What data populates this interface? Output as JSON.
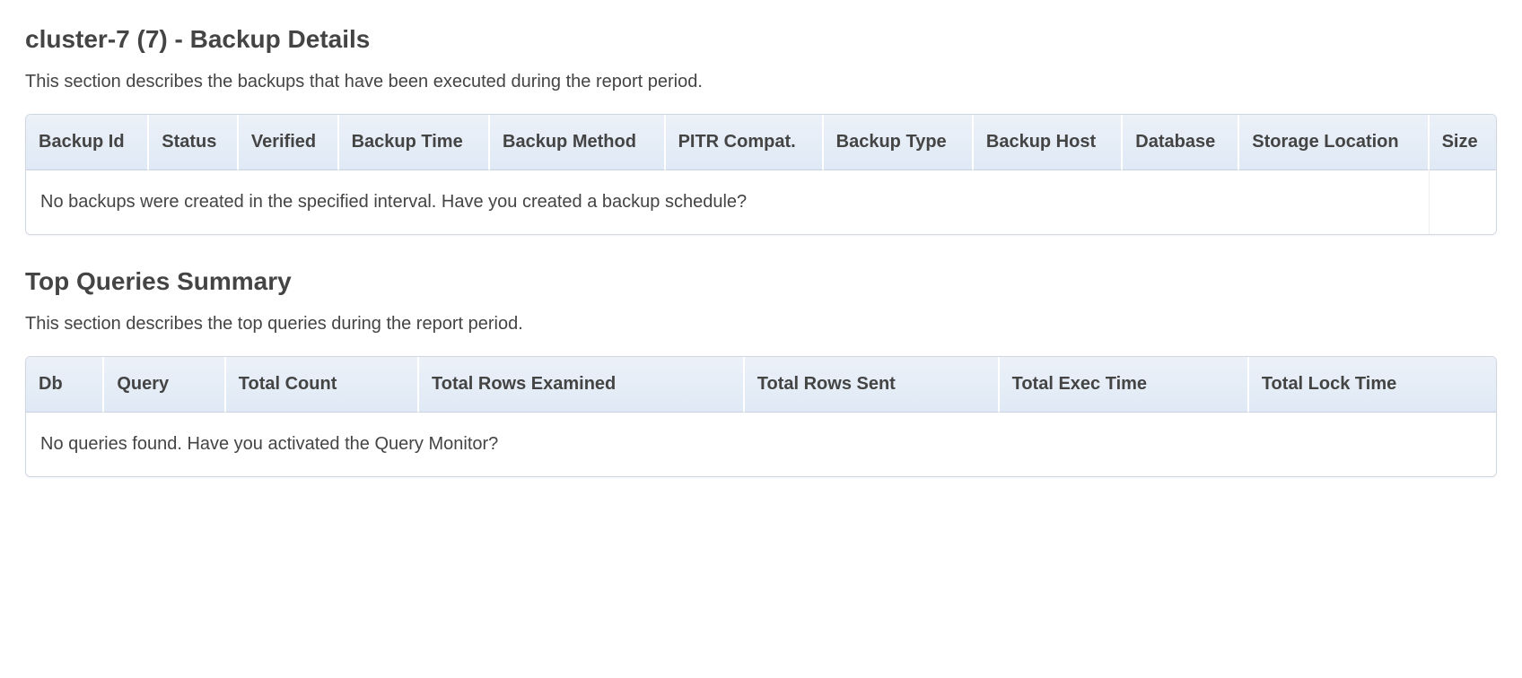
{
  "backup_section": {
    "title": "cluster-7 (7) - Backup Details",
    "description": "This section describes the backups that have been executed during the report period.",
    "columns": [
      "Backup Id",
      "Status",
      "Verified",
      "Backup Time",
      "Backup Method",
      "PITR Compat.",
      "Backup Type",
      "Backup Host",
      "Database",
      "Storage Location",
      "Size"
    ],
    "empty_message": "No backups were created in the specified interval. Have you created a backup schedule?"
  },
  "queries_section": {
    "title": "Top Queries Summary",
    "description": "This section describes the top queries during the report period.",
    "columns": [
      "Db",
      "Query",
      "Total Count",
      "Total Rows Examined",
      "Total Rows Sent",
      "Total Exec Time",
      "Total Lock Time"
    ],
    "empty_message": "No queries found. Have you activated the Query Monitor?"
  }
}
